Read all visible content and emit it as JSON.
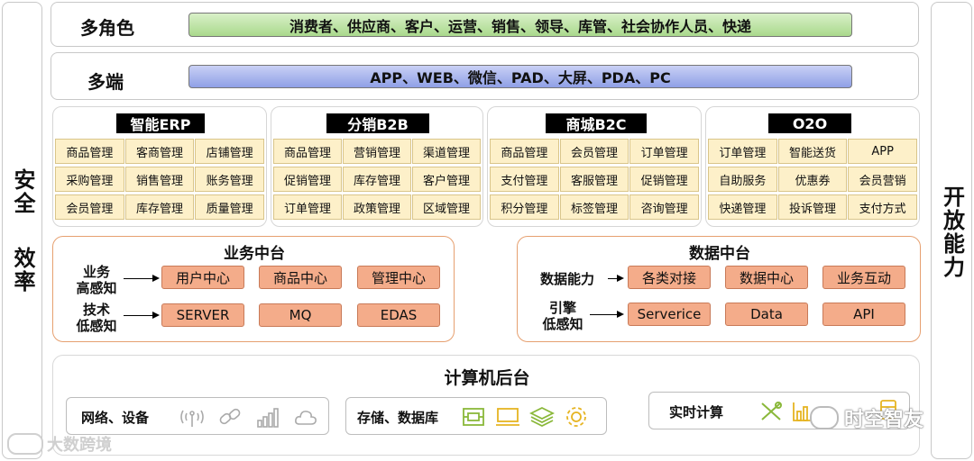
{
  "left_vertical": {
    "top": "安全",
    "bottom": "效率"
  },
  "right_vertical": "开放能力",
  "roles": {
    "label": "多角色",
    "bar": "消费者、供应商、客户、运营、销售、领导、库管、社会协作人员、快递"
  },
  "terminals": {
    "label": "多端",
    "bar": "APP、WEB、微信、PAD、大屏、PDA、PC"
  },
  "groups": [
    {
      "title": "智能ERP",
      "cells": [
        "商品管理",
        "客商管理",
        "店铺管理",
        "采购管理",
        "销售管理",
        "账务管理",
        "会员管理",
        "库存管理",
        "质量管理"
      ]
    },
    {
      "title": "分销B2B",
      "cells": [
        "商品管理",
        "营销管理",
        "渠道管理",
        "促销管理",
        "库存管理",
        "客户管理",
        "订单管理",
        "政策管理",
        "区域管理"
      ]
    },
    {
      "title": "商城B2C",
      "cells": [
        "商品管理",
        "会员管理",
        "订单管理",
        "支付管理",
        "客服管理",
        "促销管理",
        "积分管理",
        "标签管理",
        "咨询管理"
      ]
    },
    {
      "title": "O2O",
      "cells": [
        "订单管理",
        "智能送货",
        "APP",
        "自助服务",
        "优惠券",
        "会员营销",
        "快递管理",
        "投诉管理",
        "支付方式"
      ]
    }
  ],
  "business": {
    "title": "业务中台",
    "row1_label": "业务\n高感知",
    "row1": [
      "用户中心",
      "商品中心",
      "管理中心"
    ],
    "row2_label": "技术\n低感知",
    "row2": [
      "SERVER",
      "MQ",
      "EDAS"
    ]
  },
  "data_platform": {
    "title": "数据中台",
    "row1_label": "数据能力",
    "row1": [
      "各类对接",
      "数据中心",
      "业务互动"
    ],
    "row2_label": "引擎\n低感知",
    "row2": [
      "Serverice",
      "Data",
      "API"
    ]
  },
  "backend": {
    "title": "计算机后台",
    "sub1": "网络、设备",
    "sub2": "存储、数据库",
    "sub3": "实时计算"
  },
  "icons": [
    "wifi-icon",
    "link-icon",
    "signal-bars-icon",
    "cloud-icon",
    "circuit-board-icon",
    "monitor-icon",
    "layers-icon",
    "gear-icon",
    "tools-icon",
    "bar-chart-icon",
    "database-icon"
  ],
  "watermarks": {
    "left": "大数跨境",
    "right": "时空智友"
  }
}
